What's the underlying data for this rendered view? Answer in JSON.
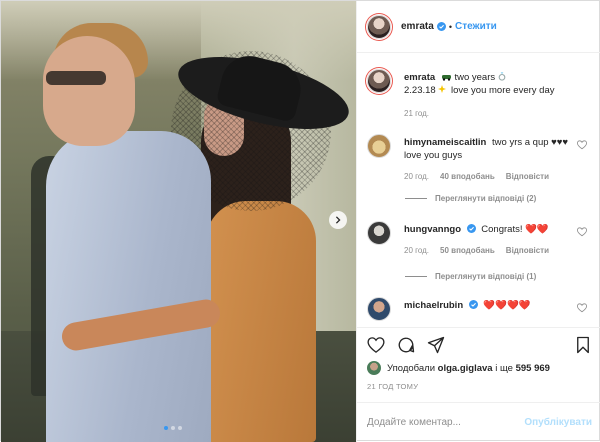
{
  "header": {
    "username": "emrata",
    "separator": "•",
    "follow_label": "Стежити"
  },
  "caption": {
    "username": "emrata",
    "text_part1": "two years",
    "text_part2": "2.23.18",
    "text_part3": "love you more every day",
    "time": "21 год."
  },
  "comments": [
    {
      "username": "himynameiscaitlin",
      "text": "two yrs a qup ♥♥♥ love you guys",
      "time": "20 год.",
      "likes": "40 вподобань",
      "reply_label": "Відповісти",
      "view_replies": "Переглянути відповіді (2)"
    },
    {
      "username": "hungvanngo",
      "text": "Congrats! ❤️❤️",
      "time": "20 год.",
      "likes": "50 вподобань",
      "reply_label": "Відповісти",
      "view_replies": "Переглянути відповіді (1)"
    },
    {
      "username": "michaelrubin",
      "text": "❤️❤️❤️❤️"
    }
  ],
  "likes": {
    "prefix": "Уподобали",
    "user": "olga.giglava",
    "middle": "і ще",
    "count": "595 969"
  },
  "timestamp": "21 ГОД ТОМУ",
  "add_comment": {
    "placeholder": "Додайте коментар...",
    "publish_label": "Опублікувати"
  },
  "carousel": {
    "slide_count": 3,
    "active_index": 0
  },
  "colors": {
    "accent": "#3897f0",
    "publish_disabled": "#b2dffc",
    "heart_red": "#ed4956",
    "muted": "#8e8e8e"
  }
}
